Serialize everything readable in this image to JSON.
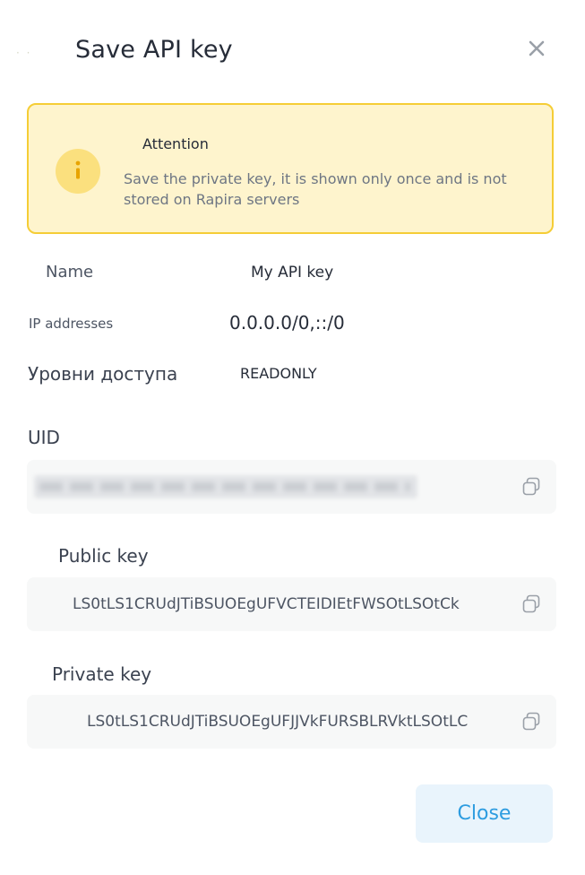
{
  "dialog": {
    "title": "Save API key",
    "close_icon": "close-icon"
  },
  "alert": {
    "icon": "info-icon",
    "title": "Attention",
    "text": "Save the private key, it is shown only once and is not stored on Rapira servers"
  },
  "details": {
    "name_label": "Name",
    "name_value": "My API key",
    "ip_label": "IP addresses",
    "ip_value": "0.0.0.0/0,::/0",
    "access_label": "Уровни доступа",
    "access_value": "READONLY"
  },
  "uid": {
    "label": "UID",
    "copy_icon": "copy-icon"
  },
  "public_key": {
    "label": "Public key",
    "value": "LS0tLS1CRUdJTiBSUOEgUFVCTEIDIEtFWSOtLSOtCk",
    "copy_icon": "copy-icon"
  },
  "private_key": {
    "label": "Private key",
    "value": "LS0tLS1CRUdJTiBSUOEgUFJJVkFURSBLRVktLSOtLC",
    "copy_icon": "copy-icon"
  },
  "footer": {
    "close_label": "Close"
  },
  "colors": {
    "accent": "#2d9ce0",
    "alert_border": "#f5cd36",
    "alert_bg": "#fef4cd",
    "alert_icon_bg": "#fbe07e"
  }
}
